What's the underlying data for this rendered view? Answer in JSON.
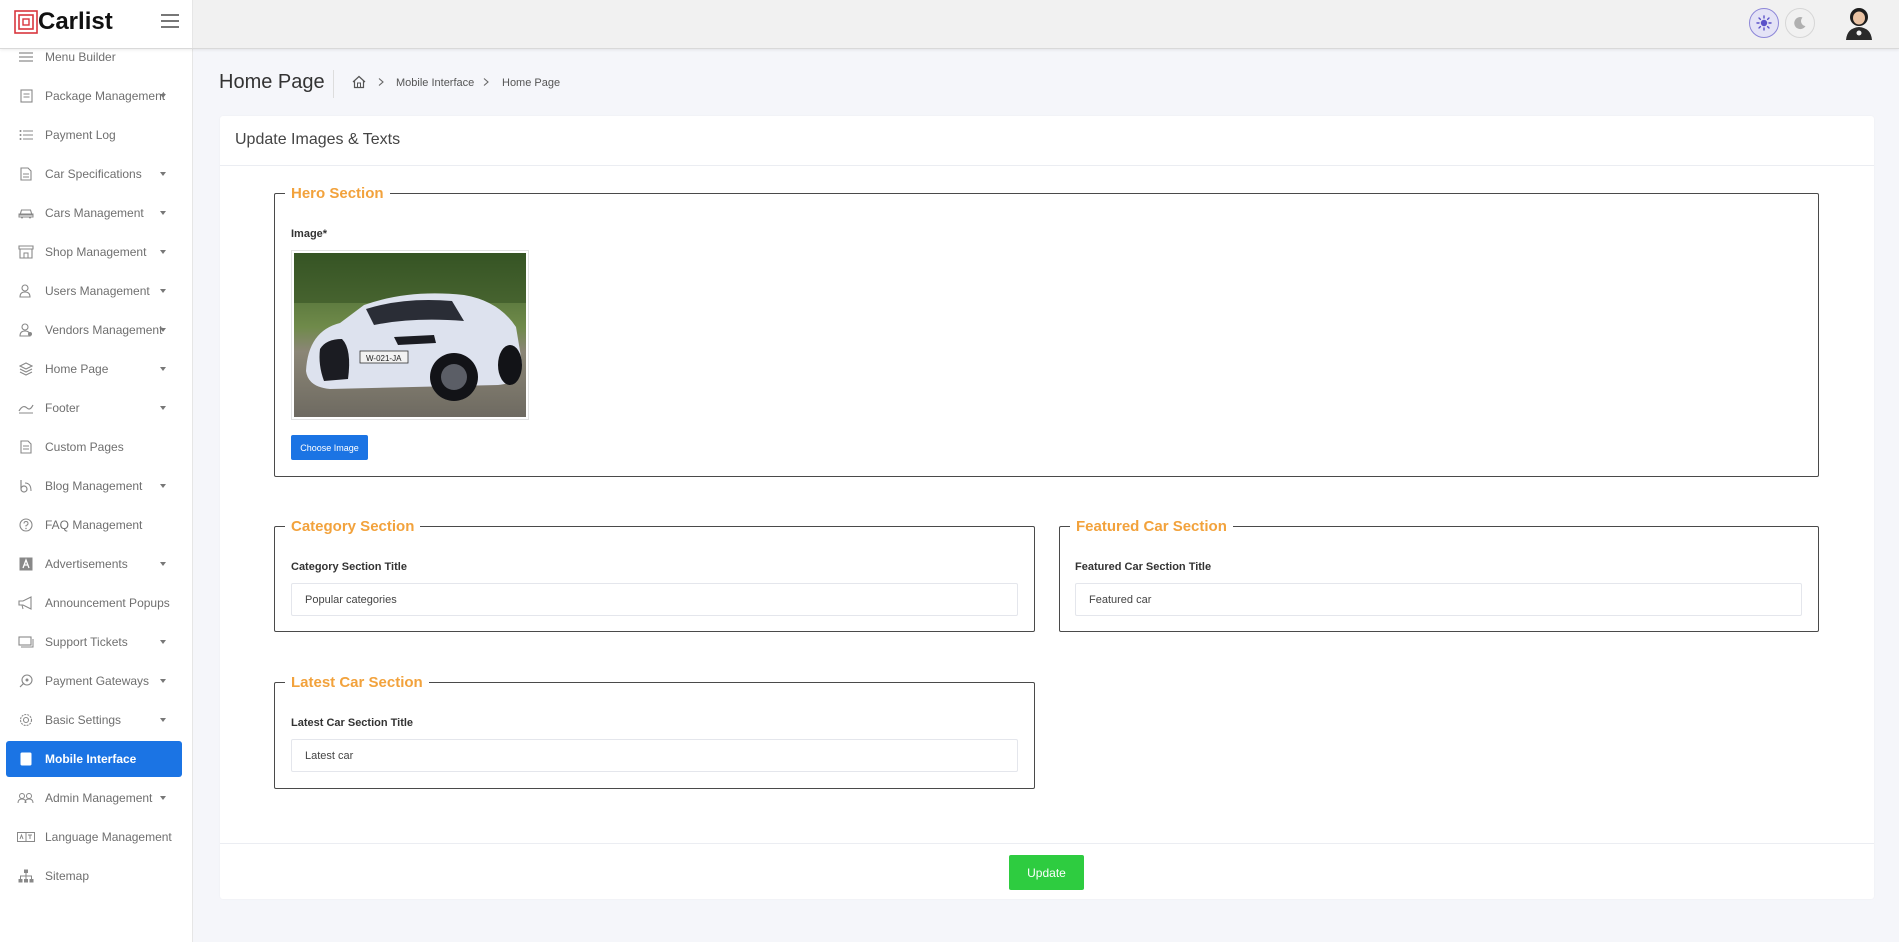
{
  "app": {
    "brand": "Carlist"
  },
  "sidebar": {
    "items": [
      {
        "label": "Menu Builder",
        "icon": "menu-lines-icon"
      },
      {
        "label": "Package Management",
        "icon": "package-icon"
      },
      {
        "label": "Payment Log",
        "icon": "list-icon"
      },
      {
        "label": "Car Specifications",
        "icon": "document-icon"
      },
      {
        "label": "Cars Management",
        "icon": "car-icon"
      },
      {
        "label": "Shop Management",
        "icon": "shop-icon"
      },
      {
        "label": "Users Management",
        "icon": "users-icon"
      },
      {
        "label": "Vendors Management",
        "icon": "vendors-icon"
      },
      {
        "label": "Home Page",
        "icon": "layers-icon"
      },
      {
        "label": "Footer",
        "icon": "footer-icon"
      },
      {
        "label": "Custom Pages",
        "icon": "page-icon"
      },
      {
        "label": "Blog Management",
        "icon": "blog-icon"
      },
      {
        "label": "FAQ Management",
        "icon": "question-icon"
      },
      {
        "label": "Advertisements",
        "icon": "ad-icon"
      },
      {
        "label": "Announcement Popups",
        "icon": "megaphone-icon"
      },
      {
        "label": "Support Tickets",
        "icon": "ticket-icon"
      },
      {
        "label": "Payment Gateways",
        "icon": "gateway-icon"
      },
      {
        "label": "Basic Settings",
        "icon": "settings-icon"
      },
      {
        "label": "Mobile Interface",
        "icon": "mobile-icon"
      },
      {
        "label": "Admin Management",
        "icon": "admin-icon"
      },
      {
        "label": "Language Management",
        "icon": "language-icon"
      },
      {
        "label": "Sitemap",
        "icon": "sitemap-icon"
      }
    ]
  },
  "page": {
    "title": "Home Page",
    "breadcrumb": [
      "Mobile Interface",
      "Home Page"
    ]
  },
  "card": {
    "title": "Update Images & Texts",
    "hero": {
      "legend": "Hero Section",
      "image_label": "Image*",
      "choose_label": "Choose Image"
    },
    "category": {
      "legend": "Category Section",
      "field_label": "Category Section Title",
      "value": "Popular categories"
    },
    "featured": {
      "legend": "Featured Car Section",
      "field_label": "Featured Car Section Title",
      "value": "Featured car"
    },
    "latest": {
      "legend": "Latest Car Section",
      "field_label": "Latest Car Section Title",
      "value": "Latest car"
    },
    "update_label": "Update"
  },
  "colors": {
    "primary": "#1b74e4",
    "success": "#2ecc40",
    "legend": "#f2a23c"
  }
}
